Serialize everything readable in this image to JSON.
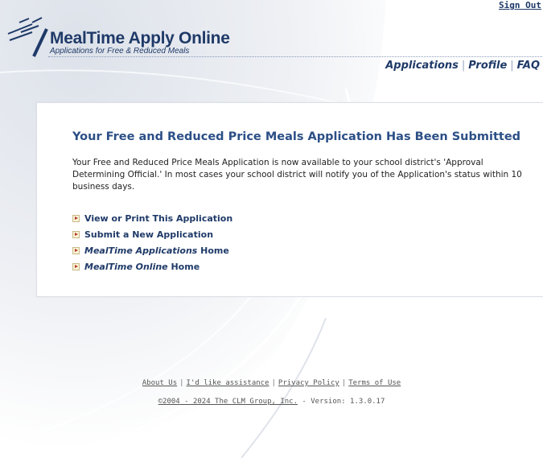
{
  "header": {
    "sign_out": "Sign Out",
    "logo": {
      "title": "MealTime Apply Online",
      "tagline": "Applications for Free & Reduced Meals"
    },
    "nav": [
      {
        "label": "Applications"
      },
      {
        "label": "Profile"
      },
      {
        "label": "FAQ"
      }
    ]
  },
  "main": {
    "title": "Your Free and Reduced Price Meals Application Has Been Submitted",
    "body": "Your Free and Reduced Price Meals Application is now available to your school district's 'Approval Determining Official.' In most cases your school district will notify you of the Application's status within 10 business days.",
    "actions": [
      {
        "label": "View or Print This Application",
        "icon": "arrow-right-icon"
      },
      {
        "label": "Submit a New Application",
        "icon": "arrow-right-icon"
      },
      {
        "italic": "MealTime Applications",
        "suffix": " Home",
        "icon": "arrow-right-icon"
      },
      {
        "italic": "MealTime Online",
        "suffix": " Home",
        "icon": "arrow-right-icon"
      }
    ]
  },
  "footer": {
    "links": [
      {
        "label": "About Us"
      },
      {
        "label": "I'd like assistance"
      },
      {
        "label": "Privacy Policy"
      },
      {
        "label": "Terms of Use"
      }
    ],
    "copyright_link": "©2004 - 2024 The CLM Group, Inc.",
    "version": " - Version: 1.3.0.17"
  },
  "colors": {
    "brand": "#1f3a68",
    "title": "#2c4f86",
    "icon_arrow": "#b0362c"
  }
}
